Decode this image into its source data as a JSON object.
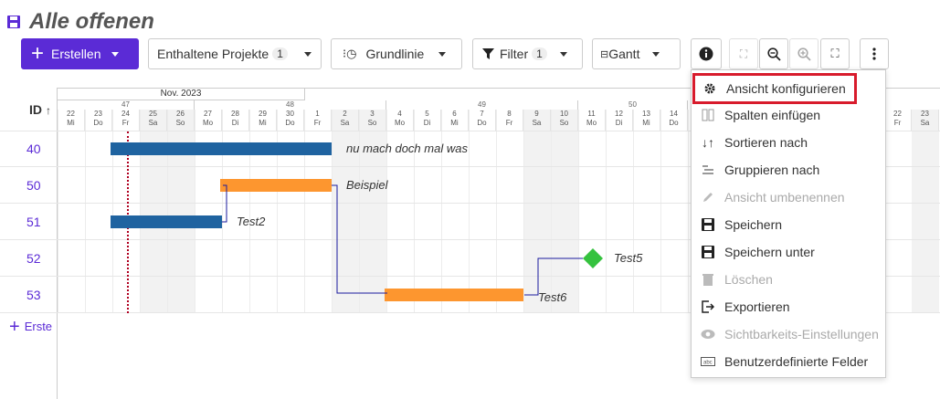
{
  "header": {
    "title": "Alle offenen"
  },
  "toolbar": {
    "create_label": "Erstellen",
    "projects_label": "Enthaltene Projekte",
    "projects_count": "1",
    "baseline_label": "Grundlinie",
    "filter_label": "Filter",
    "filter_count": "1",
    "view_label": "Gantt"
  },
  "gantt": {
    "id_header": "ID",
    "month": "Nov. 2023",
    "weeks": [
      "47",
      "48",
      "49",
      "50"
    ],
    "days": [
      {
        "d": "22",
        "w": "Mi"
      },
      {
        "d": "23",
        "w": "Do"
      },
      {
        "d": "24",
        "w": "Fr"
      },
      {
        "d": "25",
        "w": "Sa"
      },
      {
        "d": "26",
        "w": "So"
      },
      {
        "d": "27",
        "w": "Mo"
      },
      {
        "d": "28",
        "w": "Di"
      },
      {
        "d": "29",
        "w": "Mi"
      },
      {
        "d": "30",
        "w": "Do"
      },
      {
        "d": "1",
        "w": "Fr"
      },
      {
        "d": "2",
        "w": "Sa"
      },
      {
        "d": "3",
        "w": "So"
      },
      {
        "d": "4",
        "w": "Mo"
      },
      {
        "d": "5",
        "w": "Di"
      },
      {
        "d": "6",
        "w": "Mi"
      },
      {
        "d": "7",
        "w": "Do"
      },
      {
        "d": "8",
        "w": "Fr"
      },
      {
        "d": "9",
        "w": "Sa"
      },
      {
        "d": "10",
        "w": "So"
      },
      {
        "d": "11",
        "w": "Mo"
      },
      {
        "d": "12",
        "w": "Di"
      },
      {
        "d": "13",
        "w": "Mi"
      },
      {
        "d": "14",
        "w": "Do"
      }
    ],
    "days_tail": [
      {
        "d": "22",
        "w": "Fr"
      },
      {
        "d": "23",
        "w": "Sa"
      }
    ],
    "rows": [
      {
        "id": "40",
        "label": "nu mach doch mal was"
      },
      {
        "id": "50",
        "label": "Beispiel"
      },
      {
        "id": "51",
        "label": "Test2"
      },
      {
        "id": "52",
        "label": "Test5"
      },
      {
        "id": "53",
        "label": "Test6"
      }
    ],
    "create_label": "Erste",
    "colors": {
      "blue": "#1f63a0",
      "orange": "#fd962f",
      "milestone": "#35c23f",
      "accent": "#5b2bd6"
    }
  },
  "menu": {
    "items": [
      {
        "label": "Ansicht konfigurieren",
        "icon": "gear-icon",
        "disabled": false
      },
      {
        "label": "Spalten einfügen",
        "icon": "columns-icon",
        "disabled": false
      },
      {
        "label": "Sortieren nach",
        "icon": "sort-icon",
        "disabled": false
      },
      {
        "label": "Gruppieren nach",
        "icon": "group-icon",
        "disabled": false
      },
      {
        "label": "Ansicht umbenennen",
        "icon": "pencil-icon",
        "disabled": true
      },
      {
        "label": "Speichern",
        "icon": "save-icon",
        "disabled": false
      },
      {
        "label": "Speichern unter",
        "icon": "save-as-icon",
        "disabled": false
      },
      {
        "label": "Löschen",
        "icon": "trash-icon",
        "disabled": true
      },
      {
        "label": "Exportieren",
        "icon": "export-icon",
        "disabled": false
      },
      {
        "label": "Sichtbarkeits-Einstellungen",
        "icon": "eye-icon",
        "disabled": true
      },
      {
        "label": "Benutzerdefinierte Felder",
        "icon": "custom-fields-icon",
        "disabled": false
      }
    ]
  }
}
